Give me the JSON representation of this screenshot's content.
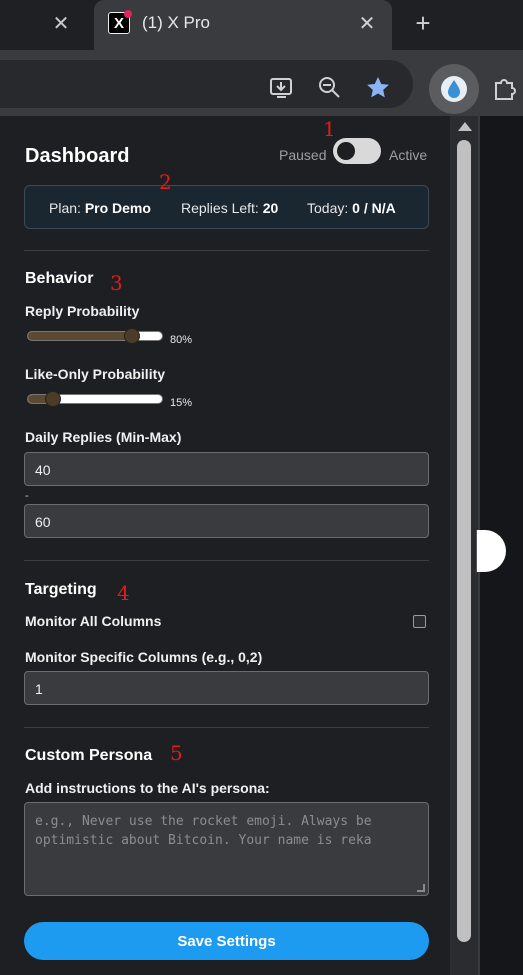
{
  "browser": {
    "tab_title": "(1) X Pro",
    "tab_favicon_letter": "X"
  },
  "dashboard": {
    "title": "Dashboard",
    "toggle_off_label": "Paused",
    "toggle_on_label": "Active",
    "toggle_active": false
  },
  "plan": {
    "plan_label": "Plan:",
    "plan_value": "Pro Demo",
    "replies_label": "Replies Left:",
    "replies_value": "20",
    "today_label": "Today:",
    "today_value": "0 / N/A"
  },
  "behavior": {
    "title": "Behavior",
    "reply_prob_label": "Reply Probability",
    "reply_prob_value": "80%",
    "reply_prob_fraction": 0.8,
    "like_prob_label": "Like-Only Probability",
    "like_prob_value": "15%",
    "like_prob_fraction": 0.15,
    "daily_replies_label": "Daily Replies (Min-Max)",
    "daily_min": "40",
    "range_separator": "-",
    "daily_max": "60"
  },
  "targeting": {
    "title": "Targeting",
    "monitor_all_label": "Monitor All Columns",
    "monitor_all_checked": false,
    "monitor_specific_label": "Monitor Specific Columns (e.g., 0,2)",
    "monitor_specific_value": "1"
  },
  "persona": {
    "title": "Custom Persona",
    "instructions_label": "Add instructions to the AI's persona:",
    "instructions_placeholder": "e.g., Never use the rocket emoji. Always be optimistic about Bitcoin. Your name is reka"
  },
  "save_button": "Save Settings",
  "annotations": [
    "1",
    "2",
    "3",
    "4",
    "5"
  ],
  "colors": {
    "accent": "#1d9bf0",
    "annotation": "#e21b1b",
    "panel_bg": "#1e1f22"
  }
}
